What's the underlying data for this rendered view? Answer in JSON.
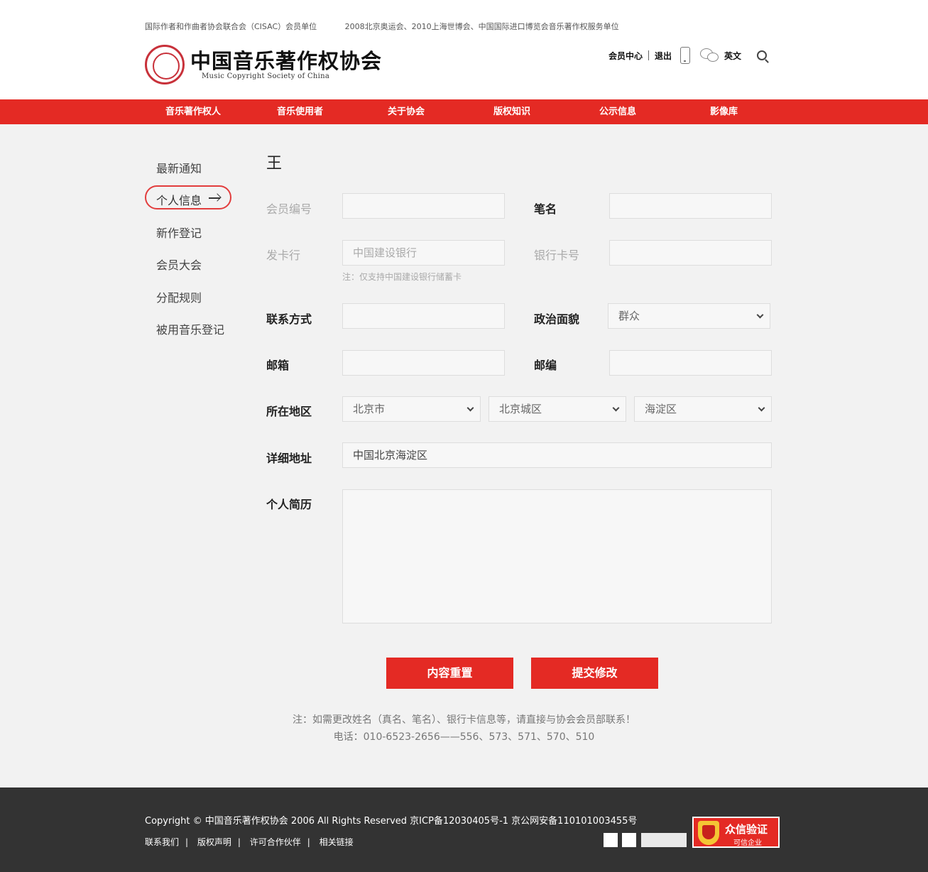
{
  "header": {
    "note_left": "国际作者和作曲者协会联合会（CISAC）会员单位",
    "note_right": "2008北京奥运会、2010上海世博会、中国国际进口博览会音乐著作权服务单位",
    "logo_cn": "中国音乐著作权协会",
    "logo_en": "Music Copyright Society of China",
    "member_center": "会员中心",
    "logout": "退出",
    "english": "英文"
  },
  "nav": [
    "音乐著作权人",
    "音乐使用者",
    "关于协会",
    "版权知识",
    "公示信息",
    "影像库"
  ],
  "sidebar": {
    "items": [
      "最新通知",
      "个人信息",
      "新作登记",
      "会员大会",
      "分配规则",
      "被用音乐登记"
    ],
    "active": "个人信息"
  },
  "form": {
    "user_name": "王",
    "member_no_label": "会员编号",
    "member_no_value": "",
    "pen_name_label": "笔名",
    "pen_name_value": "",
    "bank_label": "发卡行",
    "bank_placeholder": "中国建设银行",
    "bank_note": "注：仅支持中国建设银行储蓄卡",
    "card_no_label": "银行卡号",
    "card_no_value": "",
    "contact_label": "联系方式",
    "contact_value": "",
    "political_label": "政治面貌",
    "political_value": "群众",
    "email_label": "邮箱",
    "email_value": "",
    "postcode_label": "邮编",
    "postcode_value": "",
    "region_label": "所在地区",
    "province": "北京市",
    "city": "北京城区",
    "district": "海淀区",
    "address_label": "详细地址",
    "address_value": "中国北京海淀区",
    "resume_label": "个人简历",
    "resume_value": ""
  },
  "buttons": {
    "reset": "内容重置",
    "submit": "提交修改"
  },
  "notice": {
    "line1": "注：如需更改姓名（真名、笔名）、银行卡信息等，请直接与协会会员部联系！",
    "line2": "电话：010-6523-2656——556、573、571、570、510"
  },
  "footer": {
    "copyright": "Copyright © 中国音乐著作权协会 2006 All Rights Reserved 京ICP备12030405号-1 京公网安备110101003455号",
    "links": [
      "联系我们",
      "版权声明",
      "许可合作伙伴",
      "相关链接"
    ],
    "badge_title": "众信验证",
    "badge_sub": "可信企业"
  },
  "colors": {
    "brand_red": "#e42a24",
    "footer_bg": "#333333"
  }
}
